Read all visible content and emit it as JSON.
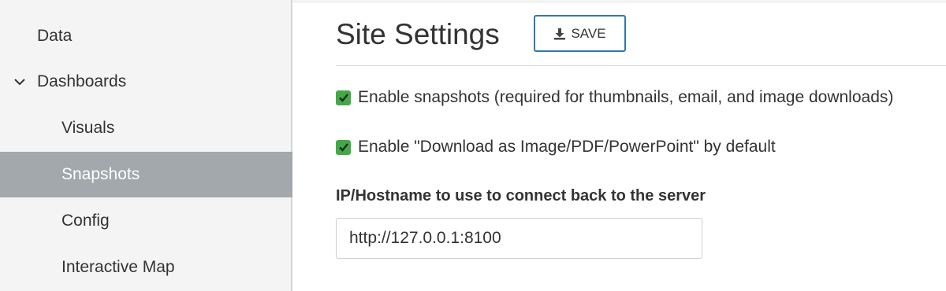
{
  "sidebar": {
    "items": [
      {
        "label": "Data"
      },
      {
        "label": "Dashboards",
        "expanded": true
      },
      {
        "label": "Visuals"
      },
      {
        "label": "Snapshots",
        "active": true
      },
      {
        "label": "Config"
      },
      {
        "label": "Interactive Map"
      }
    ]
  },
  "header": {
    "title": "Site Settings",
    "save_label": "SAVE",
    "save_icon": "download-icon"
  },
  "settings": {
    "enable_snapshots": {
      "label": "Enable snapshots (required for thumbnails, email, and image downloads)",
      "checked": true
    },
    "enable_download": {
      "label": "Enable \"Download as Image/PDF/PowerPoint\" by default",
      "checked": true
    },
    "hostname": {
      "label": "IP/Hostname to use to connect back to the server",
      "value": "http://127.0.0.1:8100"
    }
  },
  "colors": {
    "accent": "#2f7aa8",
    "checkbox": "#44a849",
    "active_nav_bg": "#a3a8ac"
  }
}
